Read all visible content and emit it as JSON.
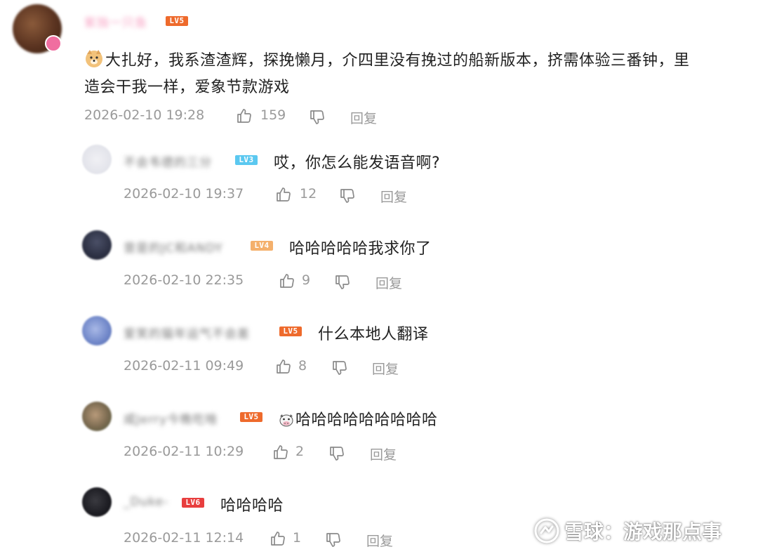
{
  "main_comment": {
    "username": "紫独一只鱼",
    "level": "LV5",
    "text_line1": "大扎好，我系渣渣辉，探挽懒月，介四里没有挽过的船新版本，挤需体验三番钟，里",
    "text_line2": "造会干我一样，爱象节款游戏",
    "timestamp": "2026-02-10 19:28",
    "likes": "159",
    "reply_label": "回复"
  },
  "replies": [
    {
      "username": "不会韦德的三分",
      "level": "LV3",
      "text": "哎，你怎么能发语音啊?",
      "timestamp": "2026-02-10 19:37",
      "likes": "12",
      "reply_label": "回复"
    },
    {
      "username": "曾是的JC和ANDY",
      "level": "LV4",
      "text": "哈哈哈哈哈我求你了",
      "timestamp": "2026-02-10 22:35",
      "likes": "9",
      "reply_label": "回复"
    },
    {
      "username": "爱笑的猫年运气不会差",
      "level": "LV5",
      "text": "什么本地人翻译",
      "timestamp": "2026-02-11 09:49",
      "likes": "8",
      "reply_label": "回复"
    },
    {
      "username": "咸Jerry今晚吃啥",
      "level": "LV5",
      "text": "哈哈哈哈哈哈哈哈哈",
      "timestamp": "2026-02-11 10:29",
      "likes": "2",
      "reply_label": "回复"
    },
    {
      "username": "_Duke-",
      "level": "LV6",
      "text": "哈哈哈哈",
      "timestamp": "2026-02-11 12:14",
      "likes": "1",
      "reply_label": "回复"
    }
  ],
  "watermark": {
    "text": "雪球：游戏那点事"
  },
  "icons": {
    "like": "thumbs-up-icon",
    "dislike": "thumbs-down-icon",
    "doge": "doge-emoji-icon",
    "cow": "cow-emoji-icon",
    "watermark_logo": "xueqiu-logo-icon"
  },
  "colors": {
    "lv3": "#5bc8f0",
    "lv4": "#f4b06c",
    "lv5": "#ee6a2c",
    "lv6": "#e83e3e",
    "meta_text": "#9a9a9a",
    "username_main": "#f7a3c4"
  }
}
